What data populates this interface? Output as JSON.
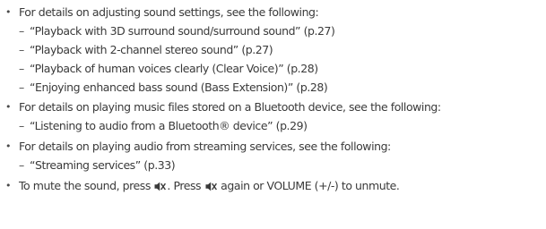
{
  "bullet_char": "•",
  "dash_char": "–",
  "sections": [
    {
      "text": "For details on adjusting sound settings, see the following:",
      "refs": [
        "“Playback with 3D surround sound/surround sound” (p.27)",
        "“Playback with 2-channel stereo sound” (p.27)",
        "“Playback of human voices clearly (Clear Voice)” (p.28)",
        "“Enjoying enhanced bass sound (Bass Extension)” (p.28)"
      ]
    },
    {
      "text": "For details on playing music files stored on a Bluetooth device, see the following:",
      "refs": [
        "“Listening to audio from a Bluetooth® device” (p.29)"
      ]
    },
    {
      "text": "For details on playing audio from streaming services, see the following:",
      "refs": [
        "“Streaming services” (p.33)"
      ]
    }
  ],
  "mute_note": {
    "part1": "To mute the sound, press ",
    "part2": ". Press ",
    "part3": " again or VOLUME (+/-) to unmute.",
    "icon": "mute-icon"
  }
}
